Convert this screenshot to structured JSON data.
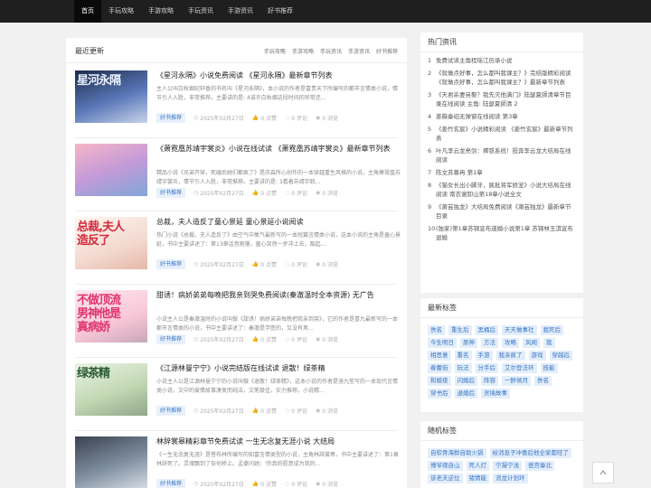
{
  "nav": [
    "首页",
    "手玩攻略",
    "手游攻略",
    "手玩资讯",
    "手游资讯",
    "好书推荐"
  ],
  "main": {
    "title": "最近更新",
    "tabs": [
      "手玩攻略",
      "手游攻略",
      "手玩资讯",
      "手游资讯",
      "好书推荐"
    ]
  },
  "articles": [
    {
      "title": "《星河永隔》小说免费阅读 《星河永隔》最新章节列表",
      "summary": "主人公叫白秋烟纪轩香的书名叫《星河永隔》，本小说的作者是富贵天下所编写的都市言情类小说，情节引人入胜，非常推荐。主要讲的是: 4诚许白秋烟这段时间的异常还...",
      "tag": "好书推荐",
      "date": "2025年02月27日",
      "likes": "0 点赞",
      "comments": "0 评论",
      "views": "0 浏览",
      "thumb_text": "星河永隔"
    },
    {
      "title": "《萧霓凰苏靖宇裳炎》小说在线试读 《萧霓凰苏靖宇裳炎》最新章节列表",
      "summary": "精品小说《兄弟齐穿，死磕后她们都疯了》是庆淼所心创作的一本穿越重生风格的小说，主角萧霓凰苏靖宇裳炎，情节引人入胜，非常推荐。主要讲的是: 3看着苏靖宇跃...",
      "tag": "好书推荐",
      "date": "2025年02月27日",
      "likes": "0 点赞",
      "comments": "0 评论",
      "views": "0 浏览",
      "thumb_text": ""
    },
    {
      "title": "总裁，夫人造反了童心景延 童心景延小说阅读",
      "summary": "热门小说《总裁，夫人造反了》由空气中氧气最新写的一本短篇言情类小说，这本小说的主角是童心景延，书中主要讲述了：第13章话音刚落，童心突然一步冲上去，踮起...",
      "tag": "好书推荐",
      "date": "2025年02月27日",
      "likes": "0 点赞",
      "comments": "0 评论",
      "views": "0 浏览",
      "thumb_text": "总裁,夫人\n造反了"
    },
    {
      "title": "甜诱！病娇弟弟每晚把我亲到哭免费阅读(秦澈温时全本资源) 无广告",
      "summary": "小说主人公是秦澈温时的小说叫做《甜诱！病娇弟弟每晚把我亲到哭》，它的作者是喜九最新写的一本都市言情类的小说，书中主要讲述了：秦澈是学医的，又没有男...",
      "tag": "好书推荐",
      "date": "2025年02月27日",
      "likes": "0 点赞",
      "comments": "0 评论",
      "views": "0 浏览",
      "thumb_text": "不做顶流\n男神他是\n真病娇"
    },
    {
      "title": "《江源林曼宁宁》小说完结版在线试读 退散！绿茶精",
      "summary": "小说主人公是江源林曼宁宁的小说叫做《退散！绿茶精》，这本小说的作者是洛九笙写的一本现代言情类小说，文中的爱情故事凄美而纯洁，文笔极佳，实力推荐。小说精...",
      "tag": "好书推荐",
      "date": "2025年02月27日",
      "likes": "0 点赞",
      "comments": "0 评论",
      "views": "0 浏览",
      "thumb_text": "绿茶精"
    },
    {
      "title": "林辞裳皋精彩章节免费试读 一生无念复无涯小说 大结局",
      "summary": "《一生无念复无涯》是菩布林所编写的知富言情类型的小说，主角林辞裳皋，书中主要讲述了：第1章林辞死了。灵魂飘到了奈何桥上。孟婆问她：'你真的愿意成为我的...",
      "tag": "好书推荐",
      "date": "2025年02月27日",
      "likes": "0 点赞",
      "comments": "0 评论",
      "views": "0 浏览",
      "thumb_text": ""
    }
  ],
  "hot": {
    "title": "热门资讯",
    "items": [
      "免费试读主角程瑶江历承小说",
      "《就做点好事，怎么都叫我课主？》完结版精彩阅读 《就做点好事，怎么都叫我课主？》最新章节列表",
      "《天君杀妻另娶？我先灭他满门》陆瑟夏師清章节目录在线阅读 主角: 陆瑟夏師清 2",
      "姜薇秦绍无弹窗在线阅读 第3章",
      "《姜竹玄宸》小说精彩阅读 《姜竹玄宸》最新章节列表",
      "叶凡李云龙亮剑：撵铁系统！投奔李云龙大结局在线阅读",
      "陈文苏慕冉 第1章",
      "《猫女长出小脚牙，疯批将军娇宠》小说大结局在线阅读 南衣谢卸山第18章小说全文",
      "《萧芸独龙》大结局免费阅读《萧芸独龙》最新章节目录",
      "(独家)第1章苏锦宣布道婚小说第1章 苏锦林玉淇宣布退婚"
    ]
  },
  "tags_section": {
    "title": "最新标签",
    "items": [
      "佚名",
      "重生后",
      "黑桶后",
      "天天做事社",
      "我死后",
      "今生明日",
      "原神",
      "方法",
      "攻略",
      "风闻",
      "我",
      "相思意",
      "重名",
      "手游",
      "我亲疯了",
      "游戏",
      "穿越后",
      "春蕾街",
      "玩法",
      "分手后",
      "艾尔登法环",
      "技能",
      "和婚夜",
      "闪婚后",
      "阵容",
      "一醉倾月",
      "佚名",
      "穿书后",
      "退婚后",
      "灵境故事"
    ]
  },
  "random": {
    "title": "随机标签",
    "items": [
      "自软骨海鲜自助火锅",
      "给消息子冲喜后他全家都旺了",
      "傅爷观自山",
      "死人灯",
      "宁凝宁浅",
      "爸宫秦北",
      "该老夫逆位",
      "猪情能",
      "流龙计划环"
    ]
  }
}
